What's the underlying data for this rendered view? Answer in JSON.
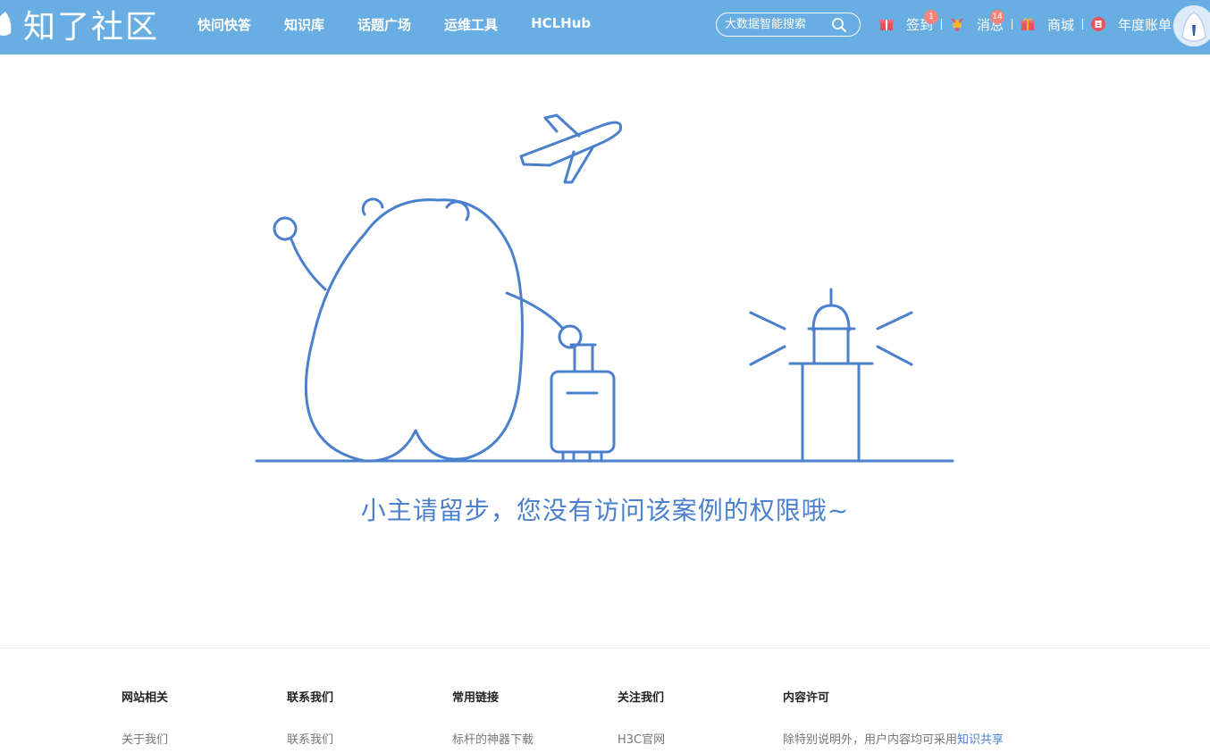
{
  "brand": {
    "name": "知了社区"
  },
  "nav": [
    "快问快答",
    "知识库",
    "话题广场",
    "运维工具",
    "HCLHub"
  ],
  "search": {
    "placeholder": "大数据智能搜索"
  },
  "actions": {
    "signin": {
      "label": "签到",
      "badge": "1"
    },
    "messages": {
      "label": "消息",
      "badge": "14"
    },
    "mall": {
      "label": "商城"
    },
    "bill": {
      "label": "年度账单"
    }
  },
  "main": {
    "message": "小主请留步，您没有访问该案例的权限哦~"
  },
  "footer": {
    "columns": [
      {
        "title": "网站相关",
        "link": "关于我们"
      },
      {
        "title": "联系我们",
        "link": "联系我们"
      },
      {
        "title": "常用链接",
        "link": "标杆的神器下载"
      },
      {
        "title": "关注我们",
        "link": "H3C官网"
      },
      {
        "title": "内容许可",
        "text": "除特别说明外，用户内容均可采用",
        "link": "知识共享"
      }
    ]
  },
  "colors": {
    "header": "#69aee3",
    "accent": "#4a80cc",
    "badge": "#f2847a"
  }
}
